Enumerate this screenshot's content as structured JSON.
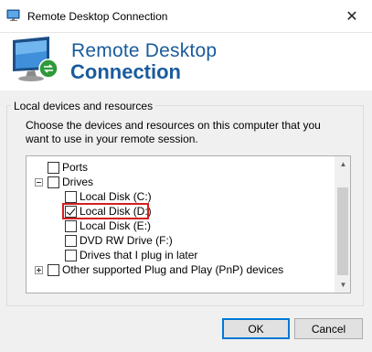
{
  "window": {
    "title": "Remote Desktop Connection",
    "close_glyph": "✕"
  },
  "banner": {
    "line1": "Remote Desktop",
    "line2": "Connection"
  },
  "group": {
    "label": "Local devices and resources",
    "description": "Choose the devices and resources on this computer that you want to use in your remote session."
  },
  "tree": {
    "items": [
      {
        "label": "Ports",
        "checked": false,
        "expander": "none"
      },
      {
        "label": "Drives",
        "checked": false,
        "expander": "minus"
      },
      {
        "label": "Local Disk (C:)",
        "checked": false,
        "expander": "none"
      },
      {
        "label": "Local Disk (D:)",
        "checked": true,
        "expander": "none",
        "highlighted": true
      },
      {
        "label": "Local Disk (E:)",
        "checked": false,
        "expander": "none"
      },
      {
        "label": "DVD RW Drive (F:)",
        "checked": false,
        "expander": "none"
      },
      {
        "label": "Drives that I plug in later",
        "checked": false,
        "expander": "none"
      },
      {
        "label": "Other supported Plug and Play (PnP) devices",
        "checked": false,
        "expander": "plus"
      }
    ]
  },
  "scrollbar": {
    "up_glyph": "▲",
    "down_glyph": "▼"
  },
  "buttons": {
    "ok": "OK",
    "cancel": "Cancel"
  },
  "colors": {
    "brand_blue": "#1a5b9c",
    "highlight_red": "#d32020",
    "default_button_border": "#0078d7"
  }
}
